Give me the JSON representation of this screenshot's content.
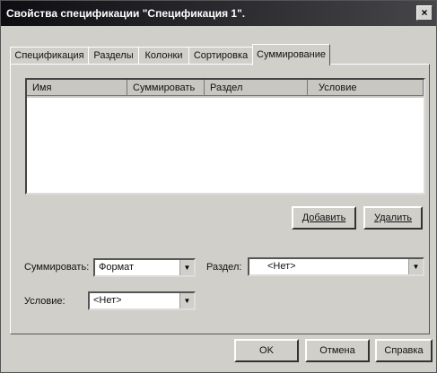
{
  "window": {
    "title": "Свойства спецификации \"Спецификация 1\".",
    "close_label": "×"
  },
  "tabs": [
    {
      "label": "Спецификация"
    },
    {
      "label": "Разделы"
    },
    {
      "label": "Колонки"
    },
    {
      "label": "Сортировка"
    },
    {
      "label": "Суммирование",
      "active": true
    }
  ],
  "table": {
    "columns": [
      "Имя",
      "Суммировать",
      "Раздел",
      "Условие"
    ],
    "rows": []
  },
  "buttons": {
    "add": "Добавить",
    "delete": "Удалить",
    "ok": "OK",
    "cancel": "Отмена",
    "help": "Справка"
  },
  "form": {
    "sum_label": "Суммировать:",
    "sum_value": "Формат",
    "section_label": "Раздел:",
    "section_value": "<Нет>",
    "condition_label": "Условие:",
    "condition_value": "<Нет>"
  },
  "icons": {
    "dropdown": "triangle-down-icon"
  }
}
